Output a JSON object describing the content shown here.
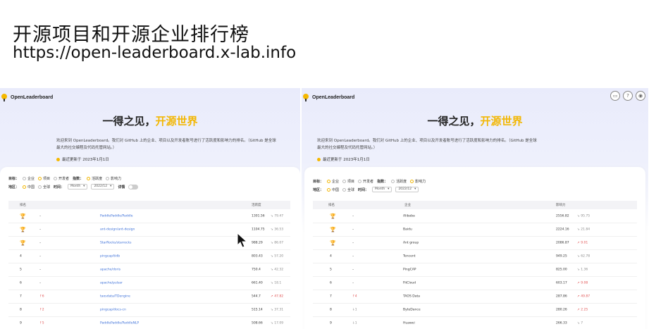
{
  "slide": {
    "title": "开源项目和开源企业排行榜",
    "url": "https://open-leaderboard.x-lab.info"
  },
  "app": {
    "logo_text": "OpenLeaderboard",
    "hero_prefix": "一得之见，",
    "hero_accent": "开源世界",
    "intro_line1": "欢迎来到 OpenLeaderboard。我们对 GitHub 上的企业、项目以及开发者账号进行了活跃度和影响力的排名。（GitHub 是全球",
    "intro_line2": "最大的社交编程及代码托管网站。）",
    "updated": "最近更新于 2023年1月1日",
    "accent_color": "#f2b705",
    "link_color": "#3b6fd8"
  },
  "left": {
    "filters": {
      "target_label": "目标：",
      "target_options": [
        "企业",
        "项目",
        "开发者"
      ],
      "metric_label": "指数：",
      "metric_options": [
        "活跃度",
        "影响力"
      ],
      "region_label": "地区：",
      "region_options": [
        "中国",
        "全球"
      ],
      "time_label": "时间：",
      "time_unit": "Month",
      "time_value": "2022/12",
      "detail_label": "详情"
    },
    "table": {
      "headers": [
        "排名",
        "",
        "",
        "活跃度"
      ],
      "rows": [
        {
          "rank": "🏆",
          "medal": "gold",
          "change": "–",
          "name": "PaddlePaddle/Paddle",
          "value": "1301.56",
          "trend": "↘ 79.47"
        },
        {
          "rank": "🏆",
          "medal": "silver",
          "change": "–",
          "name": "ant-design/ant-design",
          "value": "1104.75",
          "trend": "↘ 36.53"
        },
        {
          "rank": "🏆",
          "medal": "bronze",
          "change": "–",
          "name": "StarRocks/starrocks",
          "value": "988.29",
          "trend": "↘ 86.07"
        },
        {
          "rank": "4",
          "medal": "",
          "change": "–",
          "name": "pingcap/tidb",
          "value": "803.43",
          "trend": "↘ 57.20"
        },
        {
          "rank": "5",
          "medal": "",
          "change": "–",
          "name": "apache/doris",
          "value": "750.4",
          "trend": "↘ 42.32"
        },
        {
          "rank": "6",
          "medal": "",
          "change": "–",
          "name": "apache/pulsar",
          "value": "661.40",
          "trend": "↘ 18.1"
        },
        {
          "rank": "7",
          "medal": "",
          "change": "↑6",
          "name": "taosdata/TDengine",
          "value": "544.7",
          "trend": "↗ 47.82"
        },
        {
          "rank": "8",
          "medal": "",
          "change": "↑2",
          "name": "pingcap/docs-cn",
          "value": "515.14",
          "trend": "↘ 37.31"
        },
        {
          "rank": "9",
          "medal": "",
          "change": "↑5",
          "name": "PaddlePaddle/PaddleNLP",
          "value": "508.66",
          "trend": "↘ 17.09"
        }
      ]
    }
  },
  "right": {
    "filters": {
      "target_label": "目标：",
      "target_options": [
        "企业",
        "项目",
        "开发者"
      ],
      "metric_label": "指数：",
      "metric_options": [
        "活跃度",
        "影响力"
      ],
      "region_label": "地区：",
      "region_options": [
        "中国",
        "全球"
      ],
      "time_label": "时间：",
      "time_unit": "Month",
      "time_value": "2022/12"
    },
    "table": {
      "headers": [
        "排名",
        "",
        "企业",
        "影响力"
      ],
      "rows": [
        {
          "rank": "🏆",
          "medal": "gold",
          "change": "–",
          "name": "Alibaba",
          "value": "2556.82",
          "trend": "↘ 95.75"
        },
        {
          "rank": "🏆",
          "medal": "silver",
          "change": "–",
          "name": "Baidu",
          "value": "2224.16",
          "trend": "↘ 21.84"
        },
        {
          "rank": "🏆",
          "medal": "bronze",
          "change": "–",
          "name": "Ant group",
          "value": "2086.87",
          "trend": "↗ 9.01"
        },
        {
          "rank": "4",
          "medal": "",
          "change": "–",
          "name": "Tencent",
          "value": "949.25",
          "trend": "↘ 62.78"
        },
        {
          "rank": "5",
          "medal": "",
          "change": "–",
          "name": "PingCAP",
          "value": "825.00",
          "trend": "↘ 1.36"
        },
        {
          "rank": "6",
          "medal": "",
          "change": "–",
          "name": "FitCloud",
          "value": "603.17",
          "trend": "↗ 9.08"
        },
        {
          "rank": "7",
          "medal": "",
          "change": "↑4",
          "name": "TAOS Data",
          "value": "287.86",
          "trend": "↗ 49.87"
        },
        {
          "rank": "8",
          "medal": "",
          "change": "↓1",
          "name": "ByteDance",
          "value": "280.26",
          "trend": "↗ 2.25"
        },
        {
          "rank": "9",
          "medal": "",
          "change": "↓1",
          "name": "Huawei",
          "value": "266.33",
          "trend": "↘ 7"
        }
      ]
    }
  }
}
